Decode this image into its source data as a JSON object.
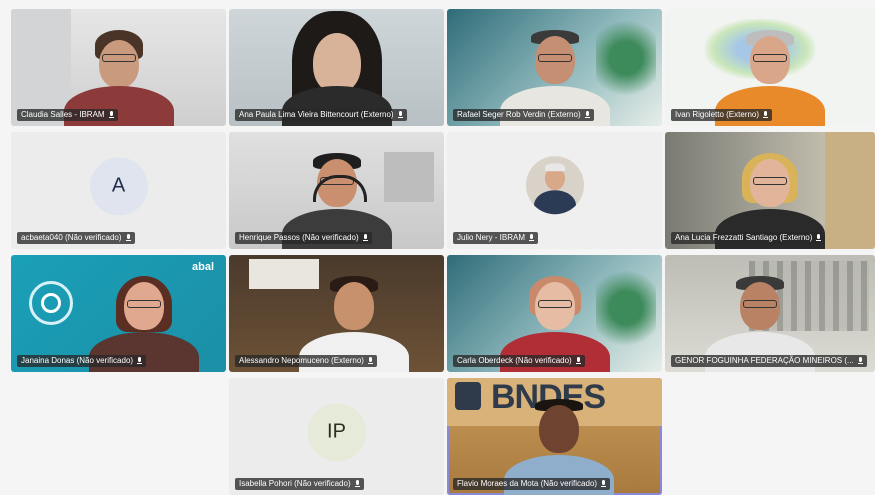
{
  "participants": [
    {
      "name": "Claudia Salles - IBRAM"
    },
    {
      "name": "Ana Paula Lima Vieira Bittencourt (Externo)"
    },
    {
      "name": "Rafael Seger Rob Verdin (Externo)"
    },
    {
      "name": "Ivan Rigoletto (Externo)"
    },
    {
      "name": "acbaeta040 (Não verificado)",
      "initials": "A"
    },
    {
      "name": "Henrique Passos (Não verificado)"
    },
    {
      "name": "Julio Nery - IBRAM"
    },
    {
      "name": "Ana Lucia Frezzatti Santiago (Externo)"
    },
    {
      "name": "Janaina Donas (Não verificado)",
      "logo": "abal"
    },
    {
      "name": "Alessandro Nepomuceno (Externo)"
    },
    {
      "name": "Carla Oberdeck (Não verificado)"
    },
    {
      "name": "GENOR FOGUINHA FEDERAÇÃO MINEIROS (..."
    },
    {
      "name": "Isabella Pohori (Não verificado)",
      "initials": "IP"
    },
    {
      "name": "Flavio Moraes da Mota (Não verificado)",
      "logo": "BNDES"
    }
  ],
  "colors": {
    "accent": "#8a88d8",
    "avatar_bg": "#dfe4ee",
    "avatar_text": "#1f2d4b",
    "tag_bg": "#282828"
  }
}
